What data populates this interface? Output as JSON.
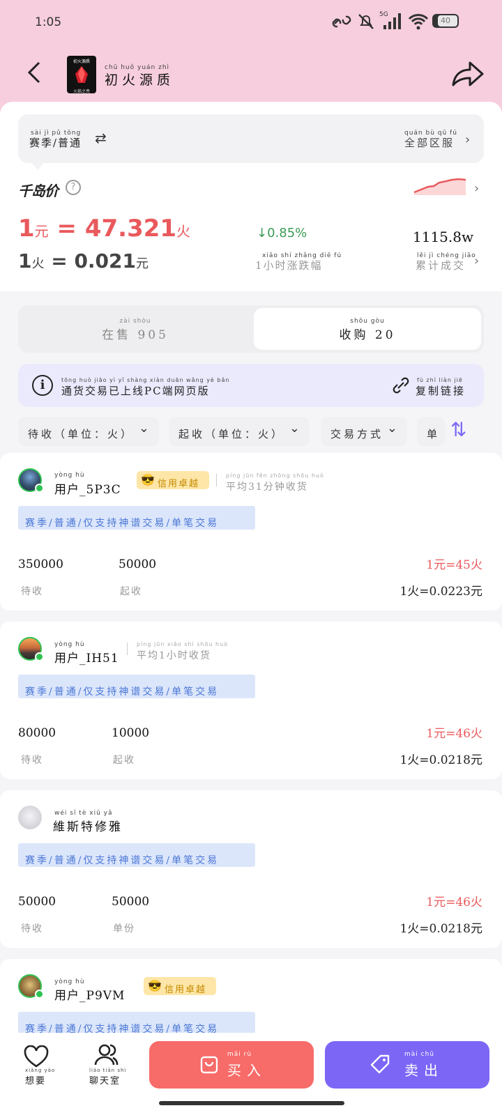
{
  "status": {
    "time": "1:05",
    "network": "5G",
    "battery": "40"
  },
  "header": {
    "title": "初火源质",
    "title_pinyin": "chū huǒ yuán zhì",
    "logo_text": "初火源质",
    "logo_subtext": "火焰之亮"
  },
  "season": {
    "label": "赛季/普通",
    "label_pinyin": "sài jì  pǔ tōng",
    "region": "全部区服",
    "region_pinyin": "quán bù qū fú"
  },
  "price": {
    "qdj_label": "千岛价",
    "rate1_one": "1",
    "rate1_unit": "元",
    "rate1_eq": " = 47.321",
    "rate1_result_unit": "火",
    "rate2_one": "1",
    "rate2_unit": "火",
    "rate2_eq": " = 0.021",
    "rate2_result_unit": "元",
    "change": "0.85%",
    "change_label": "1小时涨跌幅",
    "change_label_pinyin": "xiǎo shí zhǎng diē fú",
    "volume": "1115.8w",
    "volume_label": "累计成交",
    "volume_label_pinyin": "lěi jì chéng jiāo"
  },
  "tabs": [
    {
      "label": "在售 905",
      "pinyin": "zài shòu"
    },
    {
      "label": "收购 20",
      "pinyin": "shōu gòu"
    }
  ],
  "notice": {
    "text": "通货交易已上线PC端网页版",
    "text_pinyin": "tōng huò jiāo yì yǐ shàng xiàn       duān wǎng yè bǎn",
    "link": "复制链接",
    "link_pinyin": "fù zhì liàn jiē"
  },
  "filters": [
    {
      "label": "待收（单位：火）"
    },
    {
      "label": "起收（单位：火）"
    },
    {
      "label": "交易方式"
    },
    {
      "label": "单"
    }
  ],
  "listings": [
    {
      "name": "用户_5P3C",
      "name_pinyin": "yòng hù",
      "credit": "信用卓越",
      "credit_pinyin": "xìn yòng zhuó yuè",
      "meta": "平均31分钟收货",
      "meta_pinyin": "píng jūn      fēn zhōng shōu huò",
      "tag": "赛季/普通/仅支持神谱交易/单笔交易",
      "val1": "350000",
      "label1": "待收",
      "val2": "50000",
      "label2": "起收",
      "price_a": "1元=45火",
      "price_b": "1火=0.0223元"
    },
    {
      "name": "用户_IH51",
      "name_pinyin": "yòng hù",
      "credit": "",
      "meta": "平均1小时收货",
      "meta_pinyin": "píng jūn   xiǎo shí shōu huò",
      "tag": "赛季/普通/仅支持神谱交易/单笔交易",
      "val1": "80000",
      "label1": "待收",
      "val2": "10000",
      "label2": "起收",
      "price_a": "1元=46火",
      "price_b": "1火=0.0218元"
    },
    {
      "name": "維斯特修雅",
      "name_pinyin": "wéi sī tè xiū yǎ",
      "credit": "",
      "meta": "",
      "tag": "赛季/普通/仅支持神谱交易/单笔交易",
      "val1": "50000",
      "label1": "待收",
      "val2": "50000",
      "label2": "单份",
      "price_a": "1元=46火",
      "price_b": "1火=0.0218元"
    },
    {
      "name": "用户_P9VM",
      "name_pinyin": "yòng hù",
      "credit": "信用卓越",
      "credit_pinyin": "xìn yòng zhuó yuè",
      "meta": "",
      "tag": "赛季/普通/仅支持神谱交易/单笔交易"
    }
  ],
  "bottom": {
    "wish": "想要",
    "wish_pinyin": "xiǎng yào",
    "chat": "聊天室",
    "chat_pinyin": "liáo tiān shì",
    "buy": "买入",
    "buy_pinyin": "mǎi rù",
    "sell": "卖出",
    "sell_pinyin": "mài chū"
  },
  "colors": {
    "header_bg": "#f7cedd",
    "price_red": "#e9595c",
    "change_green": "#3b9b56",
    "accent_purple": "#7b66f6",
    "tag_blue": "#4b78d6",
    "credit_gold": "#c58a00"
  }
}
